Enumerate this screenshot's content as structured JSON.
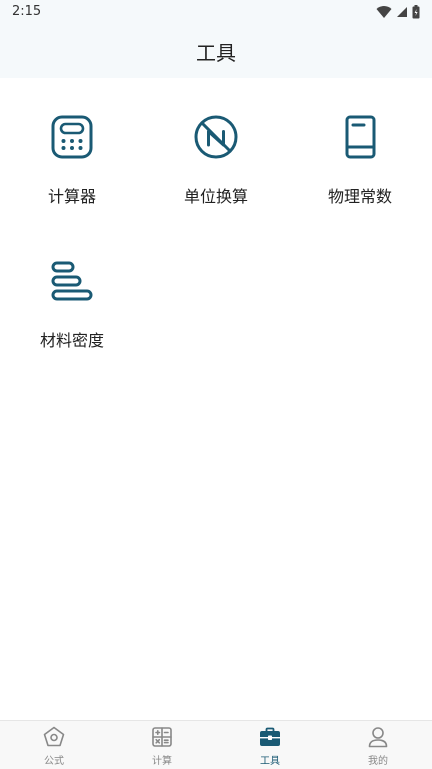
{
  "status": {
    "time": "2:15"
  },
  "header": {
    "title": "工具"
  },
  "tools": [
    {
      "label": "计算器",
      "icon": "calculator-icon"
    },
    {
      "label": "单位换算",
      "icon": "unit-convert-icon"
    },
    {
      "label": "物理常数",
      "icon": "book-icon"
    },
    {
      "label": "材料密度",
      "icon": "layers-icon"
    }
  ],
  "tabbar": {
    "items": [
      {
        "label": "公式",
        "icon": "pentagon-icon",
        "active": false
      },
      {
        "label": "计算",
        "icon": "calc-grid-icon",
        "active": false
      },
      {
        "label": "工具",
        "icon": "toolbox-icon",
        "active": true
      },
      {
        "label": "我的",
        "icon": "user-icon",
        "active": false
      }
    ]
  },
  "colors": {
    "accent": "#1a5a74",
    "inactive": "#888888",
    "header_bg": "#f5f9fb"
  }
}
